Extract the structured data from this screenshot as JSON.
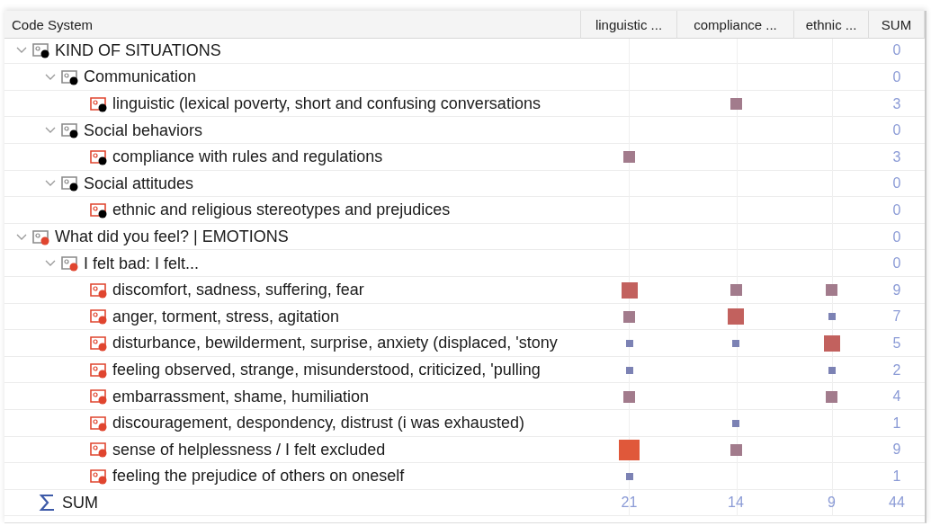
{
  "table": {
    "columns": [
      {
        "label": "Code System"
      },
      {
        "label": "linguistic ..."
      },
      {
        "label": "compliance ..."
      },
      {
        "label": "ethnic ..."
      },
      {
        "label": "SUM"
      }
    ],
    "codes": [
      {
        "name": "KIND OF SITUATIONS",
        "color": "#000000",
        "expanded": true,
        "cells": [
          null,
          null,
          null
        ],
        "sum": "0",
        "children": [
          {
            "name": "Communication",
            "color": "#000000",
            "expanded": true,
            "cells": [
              null,
              null,
              null
            ],
            "sum": "0",
            "children": [
              {
                "name": "linguistic (lexical poverty, short and confusing conversations",
                "color": "#000000",
                "cells": [
                  null,
                  {
                    "kind": "medium"
                  },
                  null
                ],
                "sum": "3"
              }
            ]
          },
          {
            "name": "Social behaviors",
            "color": "#000000",
            "expanded": true,
            "cells": [
              null,
              null,
              null
            ],
            "sum": "0",
            "children": [
              {
                "name": "compliance with rules and regulations",
                "color": "#000000",
                "cells": [
                  {
                    "kind": "medium"
                  },
                  null,
                  null
                ],
                "sum": "3"
              }
            ]
          },
          {
            "name": "Social attitudes",
            "color": "#000000",
            "expanded": true,
            "cells": [
              null,
              null,
              null
            ],
            "sum": "0",
            "children": [
              {
                "name": "ethnic and religious stereotypes and prejudices",
                "color": "#000000",
                "cells": [
                  null,
                  null,
                  null
                ],
                "sum": "0"
              }
            ]
          }
        ]
      },
      {
        "name": "What did you feel? | EMOTIONS",
        "color": "#e0452f",
        "expanded": true,
        "cells": [
          null,
          null,
          null
        ],
        "sum": "0",
        "children": [
          {
            "name": "I felt bad: I felt...",
            "color": "#e0452f",
            "expanded": true,
            "cells": [
              null,
              null,
              null
            ],
            "sum": "0",
            "children": [
              {
                "name": "discomfort, sadness, suffering, fear",
                "color": "#e0452f",
                "cells": [
                  {
                    "kind": "large"
                  },
                  {
                    "kind": "medium"
                  },
                  {
                    "kind": "medium"
                  }
                ],
                "sum": "9"
              },
              {
                "name": "anger, torment, stress, agitation",
                "color": "#e0452f",
                "cells": [
                  {
                    "kind": "medium"
                  },
                  {
                    "kind": "large"
                  },
                  {
                    "kind": "small"
                  }
                ],
                "sum": "7"
              },
              {
                "name": "disturbance, bewilderment, surprise, anxiety (displaced, 'stony",
                "color": "#e0452f",
                "cells": [
                  {
                    "kind": "small"
                  },
                  {
                    "kind": "small"
                  },
                  {
                    "kind": "large"
                  }
                ],
                "sum": "5"
              },
              {
                "name": "feeling observed, strange, misunderstood, criticized, 'pulling",
                "color": "#e0452f",
                "cells": [
                  {
                    "kind": "small"
                  },
                  null,
                  {
                    "kind": "small"
                  }
                ],
                "sum": "2"
              },
              {
                "name": "embarrassment, shame, humiliation",
                "color": "#e0452f",
                "cells": [
                  {
                    "kind": "medium"
                  },
                  null,
                  {
                    "kind": "medium"
                  }
                ],
                "sum": "4"
              },
              {
                "name": "discouragement, despondency, distrust (i was exhausted)",
                "color": "#e0452f",
                "cells": [
                  null,
                  {
                    "kind": "small"
                  },
                  null
                ],
                "sum": "1"
              },
              {
                "name": "sense of helplessness / I felt excluded",
                "color": "#e0452f",
                "cells": [
                  {
                    "kind": "xlarge"
                  },
                  {
                    "kind": "medium"
                  },
                  null
                ],
                "sum": "9"
              },
              {
                "name": "feeling the prejudice of others on oneself",
                "color": "#e0452f",
                "cells": [
                  {
                    "kind": "small"
                  },
                  null,
                  null
                ],
                "sum": "1"
              }
            ]
          }
        ]
      }
    ],
    "sum_row": {
      "label": "SUM",
      "values": [
        "21",
        "14",
        "9",
        "44"
      ]
    }
  }
}
